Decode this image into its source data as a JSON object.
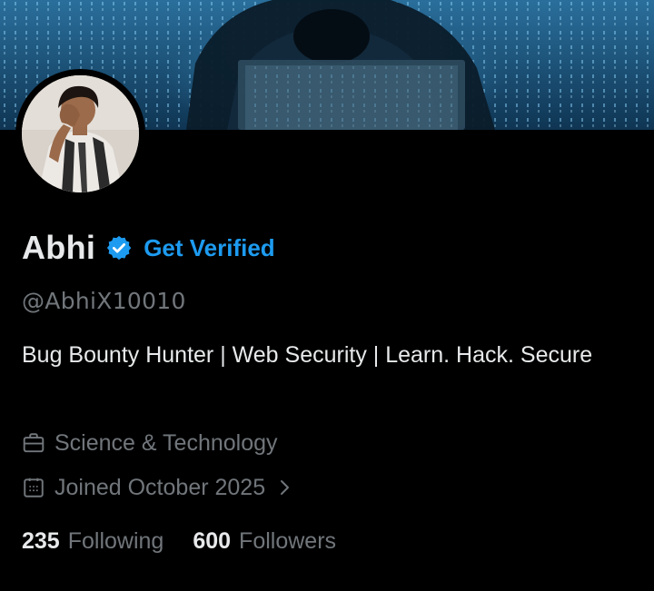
{
  "profile": {
    "display_name": "Abhi",
    "get_verified_label": "Get Verified",
    "handle": "@AbhiX10010",
    "bio": "Bug Bounty Hunter | Web Security | Learn. Hack. Secure",
    "category": "Science & Technology",
    "joined": "Joined October 2025"
  },
  "stats": {
    "following_count": "235",
    "following_label": "Following",
    "followers_count": "600",
    "followers_label": "Followers"
  },
  "icons": {
    "verified": "verified-badge-icon",
    "category": "briefcase-icon",
    "joined": "calendar-icon",
    "more": "chevron-right-icon"
  },
  "colors": {
    "background": "#000000",
    "primary_text": "#e7e9ea",
    "secondary_text": "#71767b",
    "accent": "#1d9bf0"
  }
}
